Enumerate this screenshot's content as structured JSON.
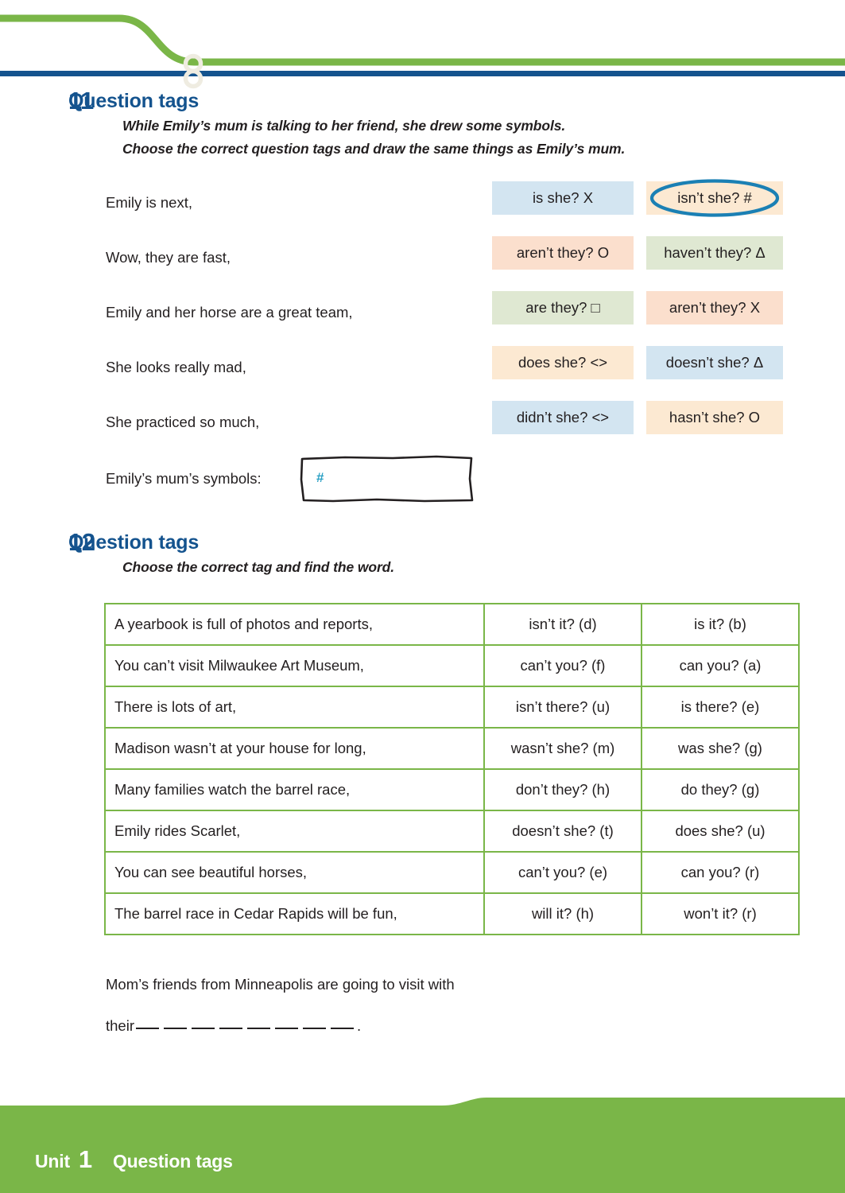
{
  "header": {
    "green_color": "#7ab648",
    "blue_color": "#14538e",
    "ring_color": "#efece1"
  },
  "exercise11": {
    "number": "11",
    "title": "Question tags",
    "instruction_line1": "While Emily’s mum is talking to her friend, she drew some symbols.",
    "instruction_line2": "Choose the correct question tags and draw the same things as Emily’s mum.",
    "rows": [
      {
        "sentence": "Emily is next,",
        "option1": {
          "text": "is she? X",
          "color": "hl-blue"
        },
        "option2": {
          "text": "isn’t she? #",
          "color": "hl-cream",
          "circled": true
        }
      },
      {
        "sentence": "Wow, they are fast,",
        "option1": {
          "text": "aren’t they? O",
          "color": "hl-peach"
        },
        "option2": {
          "text": "haven’t they? Δ",
          "color": "hl-green"
        }
      },
      {
        "sentence": "Emily and her horse are a great team,",
        "option1": {
          "text": "are they? □",
          "color": "hl-green"
        },
        "option2": {
          "text": "aren’t they? X",
          "color": "hl-peach"
        }
      },
      {
        "sentence": "She looks really mad,",
        "option1": {
          "text": "does she? <>",
          "color": "hl-cream"
        },
        "option2": {
          "text": "doesn’t she? Δ",
          "color": "hl-blue"
        }
      },
      {
        "sentence": "She practiced so much,",
        "option1": {
          "text": "didn’t she? <>",
          "color": "hl-blue"
        },
        "option2": {
          "text": "hasn’t she? O",
          "color": "hl-cream"
        }
      }
    ],
    "symbols_label": "Emily’s mum’s symbols:",
    "symbols_drawn": "#",
    "symbols_ink_color": "#2aa0c4",
    "circle_color": "#1b80b4"
  },
  "exercise12": {
    "number": "12",
    "title": "Question tags",
    "instruction": "Choose the correct tag and find the word.",
    "table_border_color": "#7ab648",
    "rows": [
      {
        "stem": "A yearbook is full of photos and reports,",
        "opt_a": "isn’t it? (d)",
        "opt_b": "is it? (b)"
      },
      {
        "stem": "You can’t visit Milwaukee Art Museum,",
        "opt_a": "can’t you? (f)",
        "opt_b": "can you? (a)"
      },
      {
        "stem": "There is lots of art,",
        "opt_a": "isn’t there? (u)",
        "opt_b": "is there? (e)"
      },
      {
        "stem": "Madison wasn’t at your house for long,",
        "opt_a": "wasn’t she? (m)",
        "opt_b": "was she? (g)"
      },
      {
        "stem": "Many families watch the barrel race,",
        "opt_a": "don’t they? (h)",
        "opt_b": "do they? (g)"
      },
      {
        "stem": "Emily rides Scarlet,",
        "opt_a": "doesn’t she? (t)",
        "opt_b": "does she? (u)"
      },
      {
        "stem": "You can see beautiful horses,",
        "opt_a": "can’t you? (e)",
        "opt_b": "can you? (r)"
      },
      {
        "stem": "The barrel race in Cedar Rapids will be fun,",
        "opt_a": "will it? (h)",
        "opt_b": "won’t it? (r)"
      }
    ],
    "riddle_line1": "Mom’s friends from Minneapolis are going to visit with",
    "riddle_word_prefix": "their",
    "riddle_blank_count": 8,
    "riddle_period": "."
  },
  "footer": {
    "unit_label": "Unit",
    "unit_number": "1",
    "topic": "Question tags",
    "background_color": "#7ab648"
  }
}
